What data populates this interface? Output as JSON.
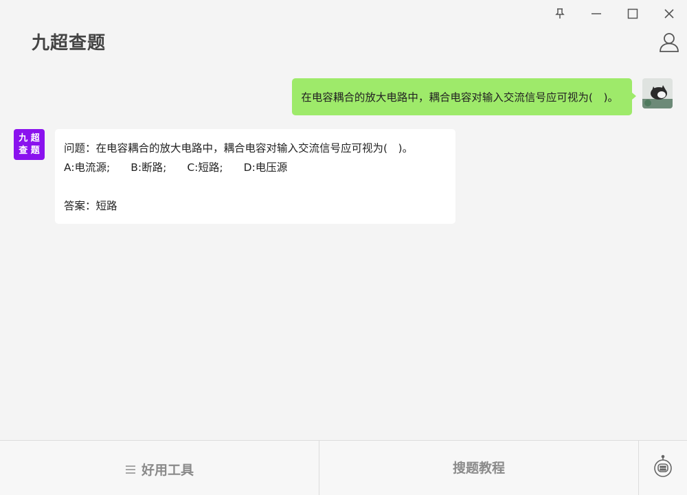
{
  "app": {
    "title": "九超查题"
  },
  "window_controls": {
    "icons": [
      "pin-icon",
      "minimize-icon",
      "maximize-icon",
      "close-icon"
    ]
  },
  "header": {
    "user_icon": "user-icon"
  },
  "chat": {
    "user_message": "在电容耦合的放大电路中，耦合电容对输入交流信号应可视为(　)。",
    "bot_avatar_chars": [
      "九",
      "超",
      "查",
      "题"
    ],
    "bot_reply": {
      "question": "问题：在电容耦合的放大电路中，耦合电容对输入交流信号应可视为(　)。",
      "options": [
        "A:电流源;",
        "B:断路;",
        "C:短路;",
        "D:电压源"
      ],
      "answer": "答案：短路"
    }
  },
  "footer": {
    "tools_label": "好用工具",
    "tutorial_label": "搜题教程",
    "robot_icon": "robot-icon"
  },
  "colors": {
    "background": "#f4f4f4",
    "user_bubble": "#9eea6a",
    "bot_avatar": "#8a12ee",
    "bot_bubble": "#ffffff"
  }
}
